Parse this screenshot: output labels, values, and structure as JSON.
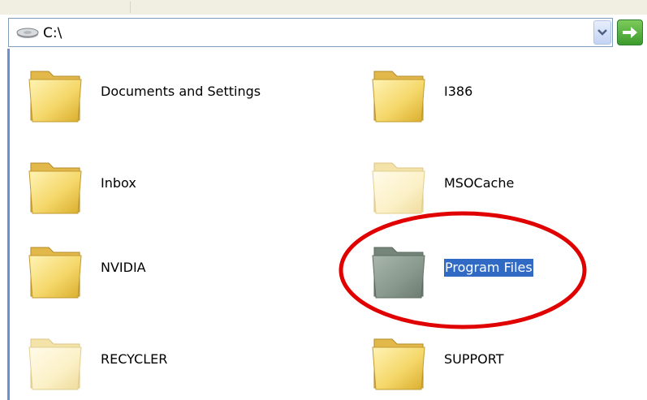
{
  "address_bar": {
    "path": "C:\\",
    "drive_icon": "hard-drive-icon",
    "dropdown_icon": "chevron-down-icon",
    "go_icon": "arrow-right-icon"
  },
  "items": [
    {
      "label": "Documents and Settings",
      "icon": "folder-icon",
      "state": "normal"
    },
    {
      "label": "I386",
      "icon": "folder-icon",
      "state": "normal"
    },
    {
      "label": "Inbox",
      "icon": "folder-icon",
      "state": "normal"
    },
    {
      "label": "MSOCache",
      "icon": "folder-icon",
      "state": "hidden"
    },
    {
      "label": "NVIDIA",
      "icon": "folder-icon",
      "state": "normal"
    },
    {
      "label": "Program Files",
      "icon": "folder-icon",
      "state": "selected"
    },
    {
      "label": "RECYCLER",
      "icon": "folder-icon",
      "state": "hidden"
    },
    {
      "label": "SUPPORT",
      "icon": "folder-icon",
      "state": "normal"
    }
  ],
  "annotation": {
    "shape": "ellipse",
    "color": "#e00000"
  },
  "colors": {
    "selection": "#316ac5",
    "folder_normal": "#f5d86b",
    "folder_hidden": "#fbf0c6",
    "folder_selected": "#8a9a8e"
  }
}
